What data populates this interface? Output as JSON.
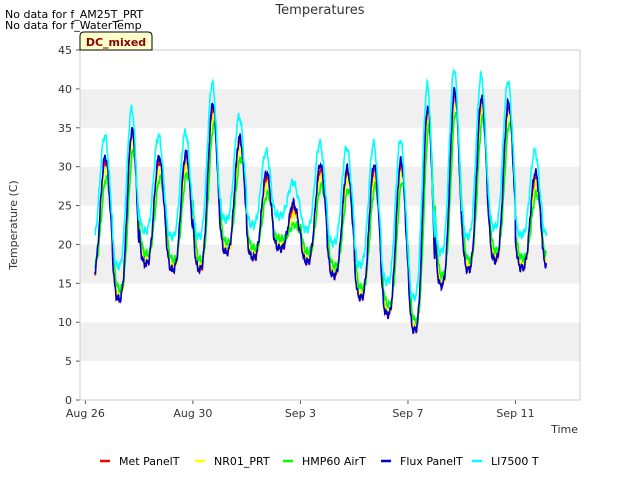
{
  "notes": [
    "No data for f_AM25T_PRT",
    "No data for f_WaterTemp"
  ],
  "badge": "DC_mixed",
  "chart_data": {
    "type": "line",
    "title": "Temperatures",
    "xlabel": "Time",
    "ylabel": "Temperature (C)",
    "ylim": [
      0,
      45
    ],
    "xlim": [
      -0.2,
      18.4
    ],
    "yticks": [
      0,
      5,
      10,
      15,
      20,
      25,
      30,
      35,
      40,
      45
    ],
    "xticks": [
      {
        "label": "Aug 26",
        "day": 0
      },
      {
        "label": "Aug 30",
        "day": 4
      },
      {
        "label": "Sep 3",
        "day": 8
      },
      {
        "label": "Sep 7",
        "day": 12
      },
      {
        "label": "Sep 11",
        "day": 16
      }
    ],
    "grid": "horizontal bands",
    "legend_position": "bottom",
    "daily_min": [
      16.0,
      13.0,
      17.5,
      16.8,
      16.8,
      19.0,
      18.3,
      19.5,
      17.8,
      16.0,
      13.2,
      11.0,
      9.0,
      14.8,
      16.8,
      18.0,
      17.0,
      17.0
    ],
    "daily_max": [
      31.0,
      34.5,
      31.0,
      31.5,
      37.8,
      33.5,
      29.0,
      25.0,
      30.0,
      29.5,
      30.0,
      30.5,
      37.5,
      39.5,
      38.7,
      38.0,
      29.0,
      26.0
    ],
    "series": [
      {
        "name": "Met PanelT",
        "color": "#ff0000",
        "dmax": -0.3,
        "dmin": 0.0,
        "offset": 0.0,
        "phase": 0.0
      },
      {
        "name": "NR01_PRT",
        "color": "#ffff00",
        "dmax": -1.2,
        "dmin": 0.4,
        "offset": 0.1,
        "phase": 0.02
      },
      {
        "name": "HMP60 AirT",
        "color": "#00ff00",
        "dmax": -2.5,
        "dmin": 1.2,
        "offset": 0.3,
        "phase": 0.03
      },
      {
        "name": "Flux PanelT",
        "color": "#0000cc",
        "dmax": 0.3,
        "dmin": 0.0,
        "offset": 0.0,
        "phase": -0.01
      },
      {
        "name": "LI7500 T",
        "color": "#00ffff",
        "dmax": 2.8,
        "dmin": 4.0,
        "offset": 1.0,
        "phase": -0.03
      }
    ]
  }
}
